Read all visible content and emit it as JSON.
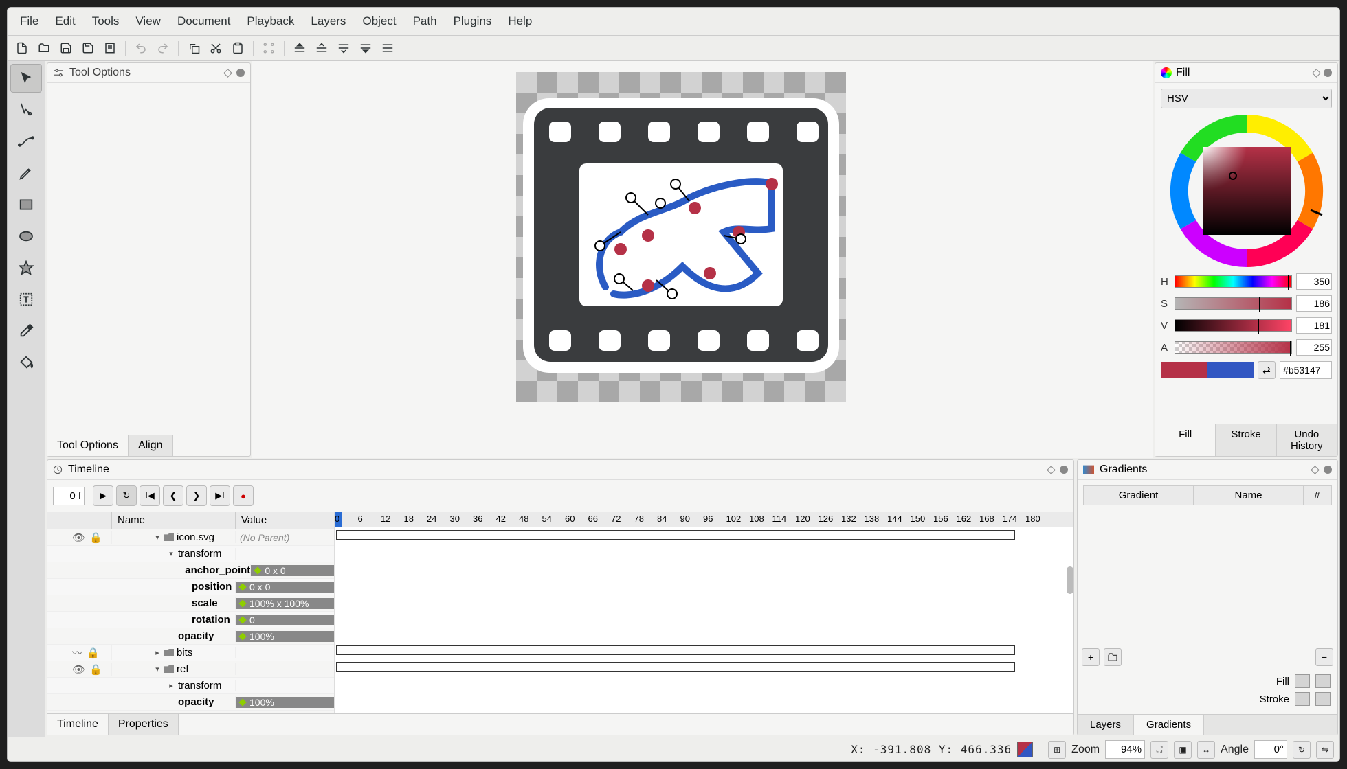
{
  "menu": [
    "File",
    "Edit",
    "Tools",
    "View",
    "Document",
    "Playback",
    "Layers",
    "Object",
    "Path",
    "Plugins",
    "Help"
  ],
  "tool_options": {
    "title": "Tool Options",
    "tabs": [
      "Tool Options",
      "Align"
    ]
  },
  "fill": {
    "title": "Fill",
    "mode": "HSV",
    "h": {
      "label": "H",
      "value": "350"
    },
    "s": {
      "label": "S",
      "value": "186"
    },
    "v": {
      "label": "V",
      "value": "181"
    },
    "a": {
      "label": "A",
      "value": "255"
    },
    "hex": "#b53147",
    "tabs": [
      "Fill",
      "Stroke",
      "Undo History"
    ]
  },
  "timeline": {
    "title": "Timeline",
    "frame": "0 f",
    "columns": {
      "name": "Name",
      "value": "Value"
    },
    "rows": [
      {
        "indent": 0,
        "chev": "▾",
        "folder": true,
        "vis": true,
        "lock": true,
        "name": "icon.svg",
        "value": "(No Parent)",
        "val_plain": true,
        "bar": true
      },
      {
        "indent": 1,
        "chev": "▾",
        "name": "transform"
      },
      {
        "indent": 2,
        "name": "anchor_point",
        "value": "0 x 0",
        "key": true,
        "bold": true
      },
      {
        "indent": 2,
        "name": "position",
        "value": "0 x 0",
        "key": true,
        "bold": true
      },
      {
        "indent": 2,
        "name": "scale",
        "value": "100% x 100%",
        "key": true,
        "bold": true
      },
      {
        "indent": 2,
        "name": "rotation",
        "value": "0",
        "key": true,
        "bold": true
      },
      {
        "indent": 1,
        "name": "opacity",
        "value": "100%",
        "key": true,
        "bold": true
      },
      {
        "indent": 0,
        "chev": "▸",
        "folder": true,
        "vis2": true,
        "lock": true,
        "name": "bits",
        "bar": true
      },
      {
        "indent": 0,
        "chev": "▾",
        "folder": true,
        "vis": true,
        "lock": true,
        "name": "ref",
        "bar": true
      },
      {
        "indent": 1,
        "chev": "▸",
        "name": "transform"
      },
      {
        "indent": 1,
        "name": "opacity",
        "value": "100%",
        "key": true,
        "bold": true
      }
    ],
    "ruler": [
      "0",
      "6",
      "12",
      "18",
      "24",
      "30",
      "36",
      "42",
      "48",
      "54",
      "60",
      "66",
      "72",
      "78",
      "84",
      "90",
      "96",
      "102",
      "108",
      "114",
      "120",
      "126",
      "132",
      "138",
      "144",
      "150",
      "156",
      "162",
      "168",
      "174",
      "180"
    ],
    "tabs": [
      "Timeline",
      "Properties"
    ]
  },
  "gradients": {
    "title": "Gradients",
    "columns": [
      "Gradient",
      "Name",
      "#"
    ],
    "fill_label": "Fill",
    "stroke_label": "Stroke",
    "tabs": [
      "Layers",
      "Gradients"
    ]
  },
  "status": {
    "coords": "X: -391.808 Y:  466.336",
    "zoom_label": "Zoom",
    "zoom_value": "94%",
    "angle_label": "Angle",
    "angle_value": "0°"
  },
  "colors": {
    "primary": "#b53147",
    "secondary": "#3256c2"
  }
}
